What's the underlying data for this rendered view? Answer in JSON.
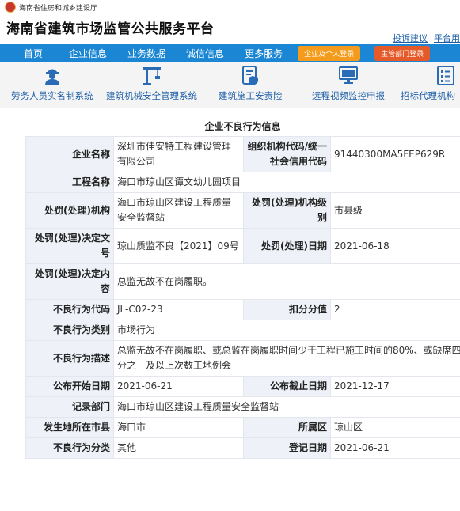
{
  "header": {
    "org_name": "海南省住房和城乡建设厅",
    "site_title": "海南省建筑市场监管公共服务平台",
    "links": [
      "投诉建议",
      "平台用"
    ]
  },
  "nav": {
    "items": [
      "首页",
      "企业信息",
      "业务数据",
      "诚信信息",
      "更多服务"
    ],
    "login_enterprise": "企业及个人登录",
    "login_dept": "主管部门登录"
  },
  "systems": [
    {
      "label": "劳务人员实名制系统",
      "icon": "worker-icon"
    },
    {
      "label": "建筑机械安全管理系统",
      "icon": "crane-icon"
    },
    {
      "label": "建筑施工安责险",
      "icon": "document-shield-icon"
    },
    {
      "label": "远程视频监控申报",
      "icon": "monitor-icon"
    },
    {
      "label": "招标代理机构",
      "icon": "checklist-icon"
    }
  ],
  "detail": {
    "title": "企业不良行为信息",
    "rows": [
      {
        "l1": "企业名称",
        "v1": "深圳市佳安特工程建设管理有限公司",
        "l2": "组织机构代码/统一社会信用代码",
        "v2": "91440300MA5FEP629R"
      },
      {
        "l1": "工程名称",
        "v1": "海口市琼山区谭文幼儿园项目"
      },
      {
        "l1": "处罚(处理)机构",
        "v1": "海口市琼山区建设工程质量安全监督站",
        "l2": "处罚(处理)机构级别",
        "v2": "市县级"
      },
      {
        "l1": "处罚(处理)决定文号",
        "v1": "琼山质监不良【2021】09号",
        "l2": "处罚(处理)日期",
        "v2": "2021-06-18"
      },
      {
        "l1": "处罚(处理)决定内容",
        "v1": "总监无故不在岗履职。"
      },
      {
        "l1": "不良行为代码",
        "v1": "JL-C02-23",
        "l2": "扣分分值",
        "v2": "2"
      },
      {
        "l1": "不良行为类别",
        "v1": "市场行为"
      },
      {
        "l1": "不良行为描述",
        "v1": "总监无故不在岗履职、或总监在岗履职时间少于工程已施工时间的80%、或缺席四分之一及以上次数工地例会"
      },
      {
        "l1": "公布开始日期",
        "v1": "2021-06-21",
        "l2": "公布截止日期",
        "v2": "2021-12-17"
      },
      {
        "l1": "记录部门",
        "v1": "海口市琼山区建设工程质量安全监督站"
      },
      {
        "l1": "发生地所在市县",
        "v1": "海口市",
        "l2": "所属区",
        "v2": "琼山区"
      },
      {
        "l1": "不良行为分类",
        "v1": "其他",
        "l2": "登记日期",
        "v2": "2021-06-21"
      }
    ]
  }
}
